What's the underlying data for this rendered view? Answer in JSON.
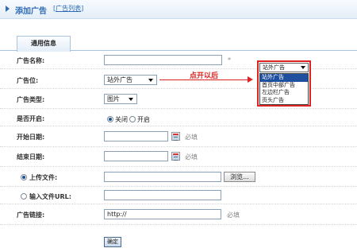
{
  "header": {
    "title": "添加广告",
    "list_link": "广告列表",
    "bracket_open": "[",
    "bracket_close": "]"
  },
  "tabs": [
    {
      "label": "通用信息"
    }
  ],
  "form": {
    "name": {
      "label": "广告名称:",
      "value": "",
      "required": "*"
    },
    "position": {
      "label": "广告位:",
      "value": "站外广告"
    },
    "type": {
      "label": "广告类型:",
      "value": "图片"
    },
    "enabled": {
      "label": "是否开启:",
      "options": [
        "关闭",
        "开启"
      ],
      "selected": "关闭"
    },
    "start_date": {
      "label": "开始日期:",
      "value": "",
      "required": "必填"
    },
    "end_date": {
      "label": "结束日期:",
      "value": "",
      "required": "必填"
    },
    "upload": {
      "label": "上传文件:",
      "value": "",
      "browse_label": "浏览..."
    },
    "file_url": {
      "label": "输入文件URL:",
      "value": ""
    },
    "link": {
      "label": "广告链接:",
      "value": "http://",
      "required": "必填"
    },
    "submit_label": "确定"
  },
  "popup": {
    "selected": "站外广告",
    "options": [
      "站外广告",
      "首页中部广告",
      "左边栏广告",
      "页头广告"
    ]
  },
  "annotation": "点开以后",
  "colors": {
    "accent": "#2e6cb5",
    "annotation": "#dd2222"
  }
}
